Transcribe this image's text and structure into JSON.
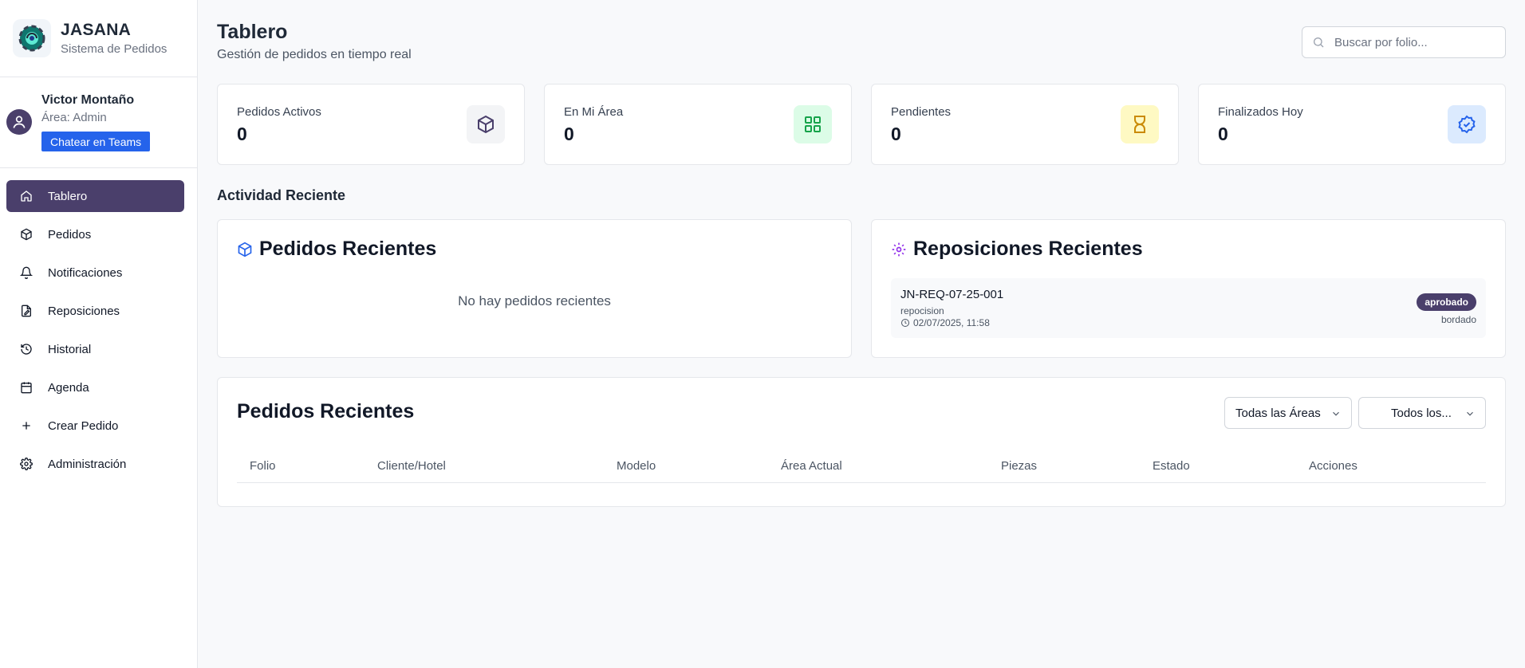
{
  "brand": {
    "name": "JASANA",
    "subtitle": "Sistema de Pedidos"
  },
  "user": {
    "name": "Victor Montaño",
    "area": "Área: Admin",
    "teams_button": "Chatear en Teams"
  },
  "nav": [
    {
      "label": "Tablero",
      "icon": "home-icon",
      "active": true
    },
    {
      "label": "Pedidos",
      "icon": "package-icon"
    },
    {
      "label": "Notificaciones",
      "icon": "bell-icon"
    },
    {
      "label": "Reposiciones",
      "icon": "file-edit-icon"
    },
    {
      "label": "Historial",
      "icon": "history-icon"
    },
    {
      "label": "Agenda",
      "icon": "calendar-icon"
    },
    {
      "label": "Crear Pedido",
      "icon": "plus-icon"
    },
    {
      "label": "Administración",
      "icon": "gear-icon"
    }
  ],
  "header": {
    "title": "Tablero",
    "subtitle": "Gestión de pedidos en tiempo real",
    "search_placeholder": "Buscar por folio..."
  },
  "stats": [
    {
      "label": "Pedidos Activos",
      "value": "0",
      "icon": "package-icon",
      "color": "#f3f4f6"
    },
    {
      "label": "En Mi Área",
      "value": "0",
      "icon": "grid-icon",
      "color": "#dcfce7"
    },
    {
      "label": "Pendientes",
      "value": "0",
      "icon": "hourglass-icon",
      "color": "#fef9c3"
    },
    {
      "label": "Finalizados Hoy",
      "value": "0",
      "icon": "badge-check-icon",
      "color": "#dbeafe"
    }
  ],
  "activity": {
    "title": "Actividad Reciente",
    "orders_panel": {
      "title": "Pedidos Recientes",
      "empty": "No hay pedidos recientes"
    },
    "repos_panel": {
      "title": "Reposiciones Recientes",
      "items": [
        {
          "folio": "JN-REQ-07-25-001",
          "type": "repocision",
          "date": "02/07/2025, 11:58",
          "status": "aprobado",
          "area": "bordado"
        }
      ]
    }
  },
  "orders_table": {
    "title": "Pedidos Recientes",
    "filter_area": "Todas las Áreas",
    "filter_status": "Todos los...",
    "columns": [
      "Folio",
      "Cliente/Hotel",
      "Modelo",
      "Área Actual",
      "Piezas",
      "Estado",
      "Acciones"
    ]
  },
  "colors": {
    "accent": "#4a3f6b",
    "primary": "#2563eb"
  }
}
